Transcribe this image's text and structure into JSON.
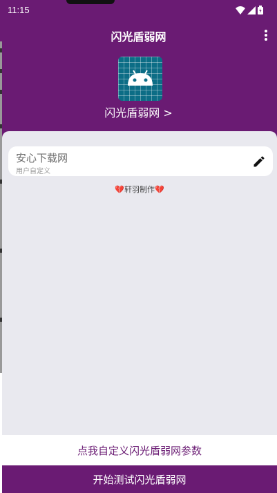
{
  "status_bar": {
    "time": "11:15",
    "icons": [
      "wifi-icon",
      "signal-icon",
      "battery-icon"
    ]
  },
  "header": {
    "title": "闪光盾弱网",
    "app_name": "闪光盾弱网 >"
  },
  "card": {
    "title": "安心下载网",
    "subtitle": "用户自定义"
  },
  "credit": {
    "text": "轩羽制作",
    "heart": "💔"
  },
  "buttons": {
    "customize": "点我自定义闪光盾弱网参数",
    "start": "开始测试闪光盾弱网"
  },
  "colors": {
    "primary": "#6a1b73",
    "background": "#e9e9ef",
    "logo": "#0c6d86",
    "android_green": "#ffffff"
  }
}
